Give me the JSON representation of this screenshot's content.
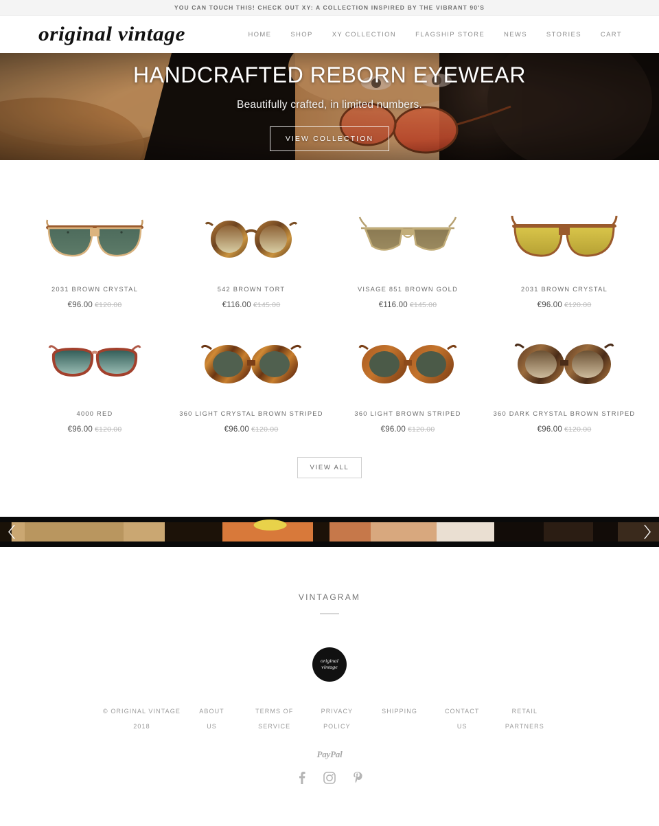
{
  "announcement": {
    "text": "YOU CAN TOUCH THIS! CHECK OUT XY: A COLLECTION INSPIRED BY THE VIBRANT 90'S"
  },
  "header": {
    "logo": "original vintage",
    "nav": [
      {
        "label": "HOME"
      },
      {
        "label": "SHOP"
      },
      {
        "label": "XY COLLECTION"
      },
      {
        "label": "FLAGSHIP STORE"
      },
      {
        "label": "NEWS"
      },
      {
        "label": "STORIES"
      },
      {
        "label": "CART"
      }
    ]
  },
  "hero": {
    "title": "HANDCRAFTED REBORN EYEWEAR",
    "subtitle": "Beautifully crafted, in limited numbers.",
    "cta": "VIEW COLLECTION"
  },
  "products": {
    "row1": [
      {
        "name": "2031 BROWN CRYSTAL",
        "price": "€96.00",
        "compare": "€120.00"
      },
      {
        "name": "542 BROWN TORT",
        "price": "€116.00",
        "compare": "€145.00"
      },
      {
        "name": "VISAGE 851 BROWN GOLD",
        "price": "€116.00",
        "compare": "€145.00"
      },
      {
        "name": "2031 BROWN CRYSTAL",
        "price": "€96.00",
        "compare": "€120.00"
      }
    ],
    "row2": [
      {
        "name": "4000 RED",
        "price": "€96.00",
        "compare": "€120.00"
      },
      {
        "name": "360 LIGHT CRYSTAL BROWN STRIPED",
        "price": "€96.00",
        "compare": "€120.00"
      },
      {
        "name": "360 LIGHT BROWN STRIPED",
        "price": "€96.00",
        "compare": "€120.00"
      },
      {
        "name": "360 DARK CRYSTAL BROWN STRIPED",
        "price": "€96.00",
        "compare": "€120.00"
      }
    ],
    "view_all": "VIEW ALL"
  },
  "carousel": {
    "prev_icon": "chevron-left-icon",
    "next_icon": "chevron-right-icon"
  },
  "vintagram": {
    "title": "VINTAGRAM"
  },
  "footer": {
    "badge_line1": "original",
    "badge_line2": "vintage",
    "links": [
      {
        "line1": "© ORIGINAL VINTAGE",
        "line2": "2018"
      },
      {
        "line1": "ABOUT",
        "line2": "US"
      },
      {
        "line1": "TERMS OF",
        "line2": "SERVICE"
      },
      {
        "line1": "PRIVACY",
        "line2": "POLICY"
      },
      {
        "line1": "",
        "line2": "SHIPPING"
      },
      {
        "line1": "CONTACT",
        "line2": "US"
      },
      {
        "line1": "RETAIL",
        "line2": "PARTNERS"
      }
    ],
    "paypal": "PayPal",
    "social": [
      {
        "icon": "facebook-icon"
      },
      {
        "icon": "instagram-icon"
      },
      {
        "icon": "pinterest-icon"
      }
    ]
  },
  "colors": {
    "announce_bg": "#f4f4f4",
    "text_muted": "#9a9a9a",
    "price": "#4d4d4d",
    "compare": "#b9b9b9",
    "badge_bg": "#111111"
  }
}
